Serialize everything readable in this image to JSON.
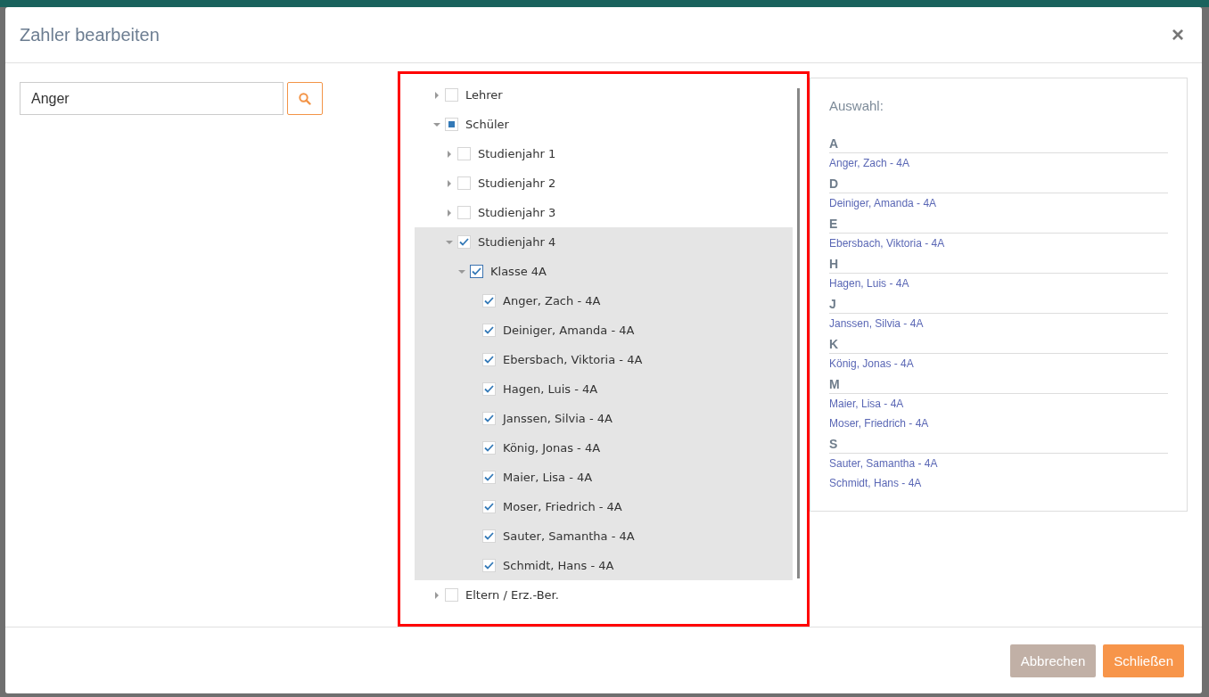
{
  "dialog": {
    "title": "Zahler bearbeiten",
    "close": "×"
  },
  "search": {
    "value": "Anger"
  },
  "tree": [
    {
      "label": "Lehrer",
      "expanded": false,
      "checked": false,
      "selected": false
    },
    {
      "label": "Schüler",
      "expanded": true,
      "checked": false,
      "indeterminate": true,
      "selected": false,
      "children": [
        {
          "label": "Studienjahr 1",
          "expanded": false,
          "checked": false,
          "selected": false
        },
        {
          "label": "Studienjahr 2",
          "expanded": false,
          "checked": false,
          "selected": false
        },
        {
          "label": "Studienjahr 3",
          "expanded": false,
          "checked": false,
          "selected": false
        },
        {
          "label": "Studienjahr 4",
          "expanded": true,
          "checked": true,
          "selected": true,
          "children": [
            {
              "label": "Klasse 4A",
              "expanded": true,
              "checked": true,
              "focused": true,
              "selected": true,
              "children": [
                {
                  "label": "Anger, Zach - 4A",
                  "checked": true,
                  "selected": true
                },
                {
                  "label": "Deiniger, Amanda - 4A",
                  "checked": true,
                  "selected": true
                },
                {
                  "label": "Ebersbach, Viktoria - 4A",
                  "checked": true,
                  "selected": true
                },
                {
                  "label": "Hagen, Luis - 4A",
                  "checked": true,
                  "selected": true
                },
                {
                  "label": "Janssen, Silvia - 4A",
                  "checked": true,
                  "selected": true
                },
                {
                  "label": "König, Jonas - 4A",
                  "checked": true,
                  "selected": true
                },
                {
                  "label": "Maier, Lisa - 4A",
                  "checked": true,
                  "selected": true
                },
                {
                  "label": "Moser, Friedrich - 4A",
                  "checked": true,
                  "selected": true
                },
                {
                  "label": "Sauter, Samantha - 4A",
                  "checked": true,
                  "selected": true
                },
                {
                  "label": "Schmidt, Hans - 4A",
                  "checked": true,
                  "selected": true
                }
              ]
            }
          ]
        }
      ]
    },
    {
      "label": "Eltern / Erz.-Ber.",
      "expanded": false,
      "checked": false,
      "selected": false
    }
  ],
  "selection": {
    "title": "Auswahl:",
    "groups": [
      {
        "letter": "A",
        "items": [
          "Anger, Zach - 4A"
        ]
      },
      {
        "letter": "D",
        "items": [
          "Deiniger, Amanda - 4A"
        ]
      },
      {
        "letter": "E",
        "items": [
          "Ebersbach, Viktoria - 4A"
        ]
      },
      {
        "letter": "H",
        "items": [
          "Hagen, Luis - 4A"
        ]
      },
      {
        "letter": "J",
        "items": [
          "Janssen, Silvia - 4A"
        ]
      },
      {
        "letter": "K",
        "items": [
          "König, Jonas - 4A"
        ]
      },
      {
        "letter": "M",
        "items": [
          "Maier, Lisa - 4A",
          "Moser, Friedrich - 4A"
        ]
      },
      {
        "letter": "S",
        "items": [
          "Sauter, Samantha - 4A",
          "Schmidt, Hans - 4A"
        ]
      }
    ]
  },
  "buttons": [
    {
      "label": "Abbrechen",
      "kind": "secondary"
    },
    {
      "label": "Schließen",
      "kind": "primary"
    }
  ]
}
